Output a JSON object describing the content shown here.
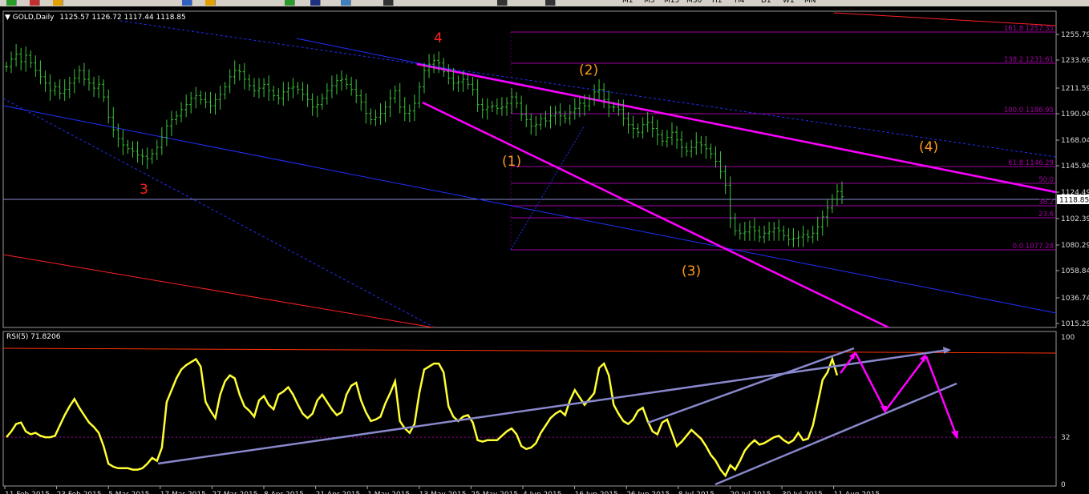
{
  "toolbar": {
    "timeframes": [
      "M1",
      "M5",
      "M15",
      "M30",
      "H1",
      "H4",
      "D1",
      "W1",
      "MN"
    ]
  },
  "price_panel": {
    "symbol": "GOLD,Daily",
    "ohlc": "1125.57 1126.72 1117.44 1118.85",
    "current_price": "1118.85",
    "y_ticks": [
      "1255.79",
      "1233.69",
      "1211.59",
      "1190.04",
      "1168.04",
      "1145.94",
      "1124.49",
      "1102.39",
      "1080.29",
      "1058.84",
      "1036.74",
      "1015.29"
    ],
    "fib_levels": [
      {
        "label": "161.8 1257.35"
      },
      {
        "label": "138.2 1231.61"
      },
      {
        "label": "100.0 1186.95"
      },
      {
        "label": "61.8 1146.29"
      },
      {
        "label": "50.0"
      },
      {
        "label": "38.2"
      },
      {
        "label": "23.6"
      },
      {
        "label": "0.0 1077.28"
      }
    ],
    "wave_labels": [
      {
        "text": "4",
        "color": "#ff2020"
      },
      {
        "text": "3",
        "color": "#ff2020"
      },
      {
        "text": "(1)",
        "color": "#ff9a1a"
      },
      {
        "text": "(2)",
        "color": "#ff9a1a"
      },
      {
        "text": "(3)",
        "color": "#ff9a1a"
      },
      {
        "text": "(4)",
        "color": "#ff9a1a"
      }
    ]
  },
  "rsi_panel": {
    "label": "RSI(5) 71.8206",
    "y_ticks": [
      "100",
      "32",
      "0"
    ]
  },
  "x_axis_labels": [
    "11 Feb 2015",
    "23 Feb 2015",
    "5 Mar 2015",
    "17 Mar 2015",
    "27 Mar 2015",
    "8 Apr 2015",
    "21 Apr 2015",
    "1 May 2015",
    "13 May 2015",
    "25 May 2015",
    "4 Jun 2015",
    "16 Jun 2015",
    "26 Jun 2015",
    "8 Jul 2015",
    "20 Jul 2015",
    "30 Jul 2015",
    "11 Aug 2015"
  ],
  "colors": {
    "bars": "#3cc43c",
    "rsi": "#ffff33",
    "magenta": "#ff00ff",
    "channel": "#2030ff",
    "fib": "#a000a0",
    "trend": "#8888cc"
  },
  "chart_data": [
    {
      "type": "bar",
      "title": "GOLD,Daily",
      "ylim": [
        1015.29,
        1266
      ],
      "closes": [
        1222,
        1228,
        1232,
        1226,
        1231,
        1225,
        1219,
        1214,
        1209,
        1203,
        1206,
        1201,
        1204,
        1209,
        1213,
        1219,
        1212,
        1209,
        1205,
        1208,
        1198,
        1182,
        1172,
        1165,
        1160,
        1157,
        1155,
        1152,
        1151,
        1149,
        1153,
        1158,
        1166,
        1175,
        1180,
        1183,
        1188,
        1192,
        1197,
        1199,
        1196,
        1194,
        1191,
        1196,
        1200,
        1206,
        1214,
        1219,
        1218,
        1212,
        1207,
        1203,
        1205,
        1208,
        1203,
        1199,
        1197,
        1202,
        1205,
        1206,
        1204,
        1200,
        1196,
        1190,
        1192,
        1197,
        1203,
        1207,
        1211,
        1212,
        1208,
        1204,
        1199,
        1194,
        1185,
        1180,
        1182,
        1185,
        1190,
        1197,
        1203,
        1190,
        1185,
        1187,
        1193,
        1206,
        1219,
        1224,
        1227,
        1225,
        1218,
        1213,
        1209,
        1210,
        1212,
        1208,
        1204,
        1192,
        1188,
        1190,
        1191,
        1189,
        1190,
        1193,
        1198,
        1193,
        1184,
        1180,
        1175,
        1176,
        1181,
        1179,
        1183,
        1186,
        1183,
        1181,
        1186,
        1189,
        1193,
        1191,
        1196,
        1202,
        1204,
        1196,
        1190,
        1190,
        1188,
        1181,
        1176,
        1173,
        1170,
        1176,
        1178,
        1173,
        1168,
        1163,
        1166,
        1170,
        1164,
        1158,
        1155,
        1158,
        1162,
        1160,
        1157,
        1153,
        1147,
        1139,
        1128,
        1102,
        1092,
        1090,
        1091,
        1095,
        1092,
        1087,
        1090,
        1091,
        1094,
        1092,
        1088,
        1085,
        1086,
        1087,
        1089,
        1087,
        1090,
        1095,
        1103,
        1110,
        1117,
        1123,
        1119
      ],
      "xlabel": "",
      "ylabel": ""
    },
    {
      "type": "line",
      "title": "RSI(5) 71.8206",
      "ylim": [
        0,
        100
      ],
      "series": [
        {
          "name": "RSI(5)",
          "values": [
            32,
            36,
            41,
            42,
            36,
            34,
            35,
            33,
            32,
            32,
            33,
            40,
            47,
            53,
            58,
            52,
            47,
            42,
            39,
            35,
            26,
            14,
            12,
            11,
            11,
            11,
            10,
            10,
            11,
            14,
            18,
            16,
            25,
            56,
            64,
            72,
            78,
            81,
            83,
            85,
            80,
            56,
            50,
            45,
            61,
            70,
            74,
            72,
            61,
            53,
            50,
            46,
            57,
            60,
            54,
            51,
            61,
            63,
            66,
            61,
            54,
            48,
            45,
            48,
            57,
            61,
            56,
            51,
            47,
            49,
            61,
            67,
            69,
            57,
            49,
            43,
            44,
            46,
            55,
            62,
            70,
            43,
            38,
            35,
            41,
            62,
            78,
            80,
            82,
            82,
            76,
            53,
            46,
            43,
            46,
            47,
            42,
            30,
            29,
            30,
            30,
            30,
            33,
            36,
            38,
            34,
            26,
            24,
            25,
            28,
            35,
            40,
            45,
            48,
            50,
            47,
            57,
            64,
            59,
            54,
            58,
            62,
            79,
            82,
            74,
            54,
            48,
            43,
            41,
            44,
            50,
            52,
            43,
            36,
            34,
            42,
            44,
            35,
            26,
            29,
            33,
            37,
            34,
            31,
            26,
            20,
            16,
            10,
            6,
            13,
            10,
            16,
            23,
            27,
            30,
            27,
            28,
            30,
            32,
            33,
            30,
            28,
            30,
            35,
            30,
            31,
            40,
            55,
            71,
            76,
            85,
            74
          ]
        }
      ],
      "levels": [
        32,
        70
      ],
      "xlabel": "",
      "ylabel": ""
    }
  ]
}
